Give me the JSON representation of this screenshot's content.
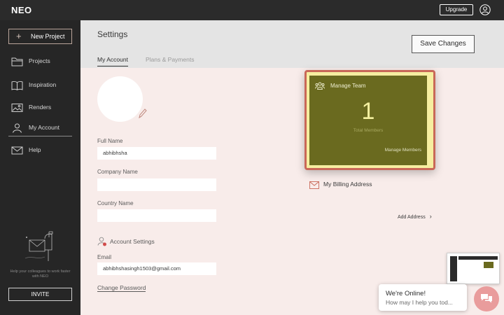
{
  "topbar": {
    "brand": "NEO",
    "upgrade_label": "Upgrade",
    "user_icon": "user-circle-icon"
  },
  "sidebar": {
    "new_project": {
      "plus": "+",
      "label": "New Project"
    },
    "items": [
      {
        "label": "Projects",
        "icon": "folder-icon"
      },
      {
        "label": "Inspiration",
        "icon": "book-icon"
      },
      {
        "label": "Renders",
        "icon": "image-icon"
      },
      {
        "label": "My Account",
        "icon": "person-icon",
        "active": true
      },
      {
        "label": "Help",
        "icon": "mail-icon"
      }
    ],
    "help_text": "Help your colleagues to work faster with NEO",
    "invite_label": "INVITE"
  },
  "header": {
    "title": "Settings",
    "tabs": [
      {
        "label": "My Account",
        "active": true
      },
      {
        "label": "Plans & Payments",
        "active": false
      }
    ],
    "save_label": "Save Changes"
  },
  "form": {
    "full_name_label": "Full Name",
    "full_name_value": "abhibhsha",
    "company_label": "Company Name",
    "company_value": "",
    "country_label": "Country Name",
    "country_value": "",
    "account_settings_label": "Account Settings",
    "email_label": "Email",
    "email_value": "abhibhshasingh1503@gmail.com",
    "change_password_label": "Change Password"
  },
  "team_card": {
    "title": "Manage Team",
    "count": "1",
    "count_label": "Total Members",
    "link_label": "Manage Members"
  },
  "billing": {
    "label": "My Billing Address",
    "add_address_label": "Add Address",
    "chevron": "›"
  },
  "chat": {
    "title": "We're Online!",
    "subtitle": "How may I help you tod..."
  },
  "colors": {
    "accent_card": "#6a6a1f",
    "card_border": "#c96858",
    "sidebar_bg": "#262626",
    "content_bg": "#f8ecea"
  }
}
